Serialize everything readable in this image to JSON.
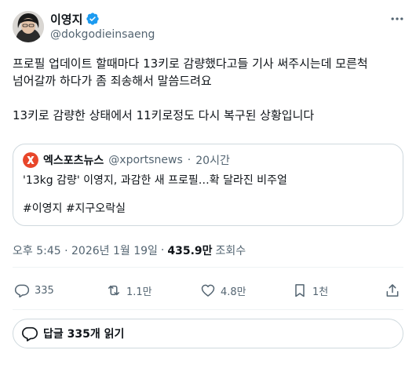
{
  "author": {
    "display_name": "이영지",
    "handle": "@dokgodieinsaeng",
    "verified": true
  },
  "tweet": {
    "lines": [
      "프로필 업데이트 할때마다 13키로 감량했다고들 기사 써주시는데 모른척",
      "넘어갈까 하다가 좀 죄송해서 말씀드려요",
      "13키로 감량한 상태에서 11키로정도 다시 복구된 상황입니다"
    ]
  },
  "quote": {
    "source_name": "엑스포츠뉴스",
    "source_handle": "@xportsnews",
    "separator": "·",
    "time": "20시간",
    "headline": "'13kg 감량' 이영지, 과감한 새 프로필…확 달라진 비주얼",
    "hashtags": "#이영지 #지구오락실"
  },
  "meta": {
    "timestamp": "오후 5:45 · 2026년 1월 19일",
    "separator": "·",
    "views": "435.9만",
    "views_label": "조회수"
  },
  "actions": {
    "reply_count": "335",
    "retweet_count": "1.1만",
    "like_count": "4.8만",
    "bookmark_count": "1천"
  },
  "reply_button": {
    "label": "답글 335개 읽기"
  },
  "colors": {
    "verified": "#1d9bf0",
    "secondary_text": "#536471",
    "primary_text": "#0f1419",
    "border": "#cfd9de",
    "quote_logo": "#e8462a"
  }
}
